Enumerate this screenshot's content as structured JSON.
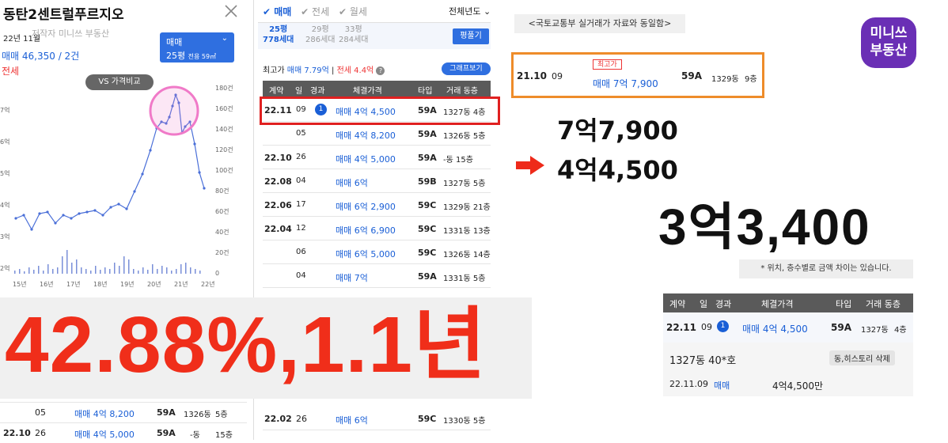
{
  "left": {
    "title": "동탄2센트럴푸르지오",
    "period": "22년 11월",
    "watermark": "저작자 미니쓰 부동산",
    "sale_summary": "매매 46,350 / 2건",
    "lease_label": "전세",
    "trade_box": {
      "type": "매매",
      "size": "25평",
      "area": "전용 59㎡"
    },
    "vs_button": "VS 가격비교",
    "chart_left_ticks": [
      "7억",
      "6억",
      "5억",
      "4억",
      "3억",
      "2억"
    ],
    "chart_right_ticks": [
      "180건",
      "160건",
      "140건",
      "120건",
      "100건",
      "80건",
      "60건",
      "40건",
      "20건",
      "0"
    ],
    "chart_x_ticks": [
      "15년",
      "16년",
      "17년",
      "18년",
      "19년",
      "20년",
      "21년",
      "22년"
    ],
    "bottom_rows": [
      {
        "day": "05",
        "price": "매매 4억 8,200",
        "type": "59A",
        "dong": "1326동",
        "floor": "5층"
      },
      {
        "contract": "22.10",
        "day": "26",
        "price": "매매 4억 5,000",
        "type": "59A",
        "dong": "-동",
        "floor": "15층"
      }
    ]
  },
  "big_stat": "42.88%,1.1년",
  "middle": {
    "filters": [
      {
        "label": "매매",
        "active": true
      },
      {
        "label": "전세",
        "active": false
      },
      {
        "label": "월세",
        "active": false
      }
    ],
    "year_select": "전체년도",
    "size_tabs": [
      {
        "size": "25평",
        "households": "778세대",
        "active": true
      },
      {
        "size": "29평",
        "households": "286세대",
        "active": false
      },
      {
        "size": "33평",
        "households": "284세대",
        "active": false
      }
    ],
    "filter_button": "평풀기",
    "max_price_label": "최고가",
    "max_price_sale": "매매 7.79억",
    "max_price_lease": "전세 4.4억",
    "graph_button": "그래프보기",
    "headers": [
      "계약",
      "일",
      "경과",
      "체결가격",
      "타입",
      "거래 동층"
    ],
    "rows": [
      {
        "contract": "22.11",
        "day": "09",
        "badge": "1",
        "price": "매매 4억 4,500",
        "type": "59A",
        "dongfloor": "1327동 4층"
      },
      {
        "contract": "",
        "day": "05",
        "badge": "",
        "price": "매매 4억 8,200",
        "type": "59A",
        "dongfloor": "1326동 5층"
      },
      {
        "contract": "22.10",
        "day": "26",
        "badge": "",
        "price": "매매 4억 5,000",
        "type": "59A",
        "dongfloor": "-동 15층"
      },
      {
        "contract": "22.08",
        "day": "04",
        "badge": "",
        "price": "매매 6억",
        "type": "59B",
        "dongfloor": "1327동 5층"
      },
      {
        "contract": "22.06",
        "day": "17",
        "badge": "",
        "price": "매매 6억 2,900",
        "type": "59C",
        "dongfloor": "1329동 21층"
      },
      {
        "contract": "22.04",
        "day": "12",
        "badge": "",
        "price": "매매 6억 6,900",
        "type": "59C",
        "dongfloor": "1331동 13층"
      },
      {
        "contract": "",
        "day": "06",
        "badge": "",
        "price": "매매 6억 5,000",
        "type": "59C",
        "dongfloor": "1326동 14층"
      },
      {
        "contract": "",
        "day": "04",
        "badge": "",
        "price": "매매 7억",
        "type": "59A",
        "dongfloor": "1331동 5층"
      }
    ],
    "bottom_row": {
      "contract": "22.02",
      "day": "26",
      "price": "매매 6억",
      "type": "59C",
      "dongfloor": "1330동 5층"
    }
  },
  "right": {
    "source_note": "<국토교통부 실거래가 자료와 동일함>",
    "logo_line1": "미니쓰",
    "logo_line2": "부동산",
    "max_box": {
      "contract": "21.10",
      "day": "09",
      "badge": "최고가",
      "price": "매매 7억 7,900",
      "type": "59A",
      "dong": "1329동",
      "floor": "9층"
    },
    "price_before": "7억7,900",
    "price_after": "4억4,500",
    "price_diff": "3억3,400",
    "disclaimer": "* 위치, 층수별로 금액 차이는 있습니다.",
    "detail_headers": [
      "계약",
      "일",
      "경과",
      "체결가격",
      "타입",
      "거래 동층"
    ],
    "detail_row": {
      "contract": "22.11",
      "day": "09",
      "badge": "1",
      "price": "매매 4억 4,500",
      "type": "59A",
      "dong": "1327동",
      "floor": "4층"
    },
    "detail_unit": "1327동 40*호",
    "detail_delete": "동,히스토리 삭제",
    "detail_date": "22.11.09",
    "detail_type": "매매",
    "detail_amount": "4억4,500만"
  },
  "colors": {
    "accent": "#2f6fe0",
    "highlight_red": "#e02020",
    "stat_red": "#f02e1a",
    "orange": "#ee8c2a",
    "logo_purple": "#6a2fb5"
  }
}
